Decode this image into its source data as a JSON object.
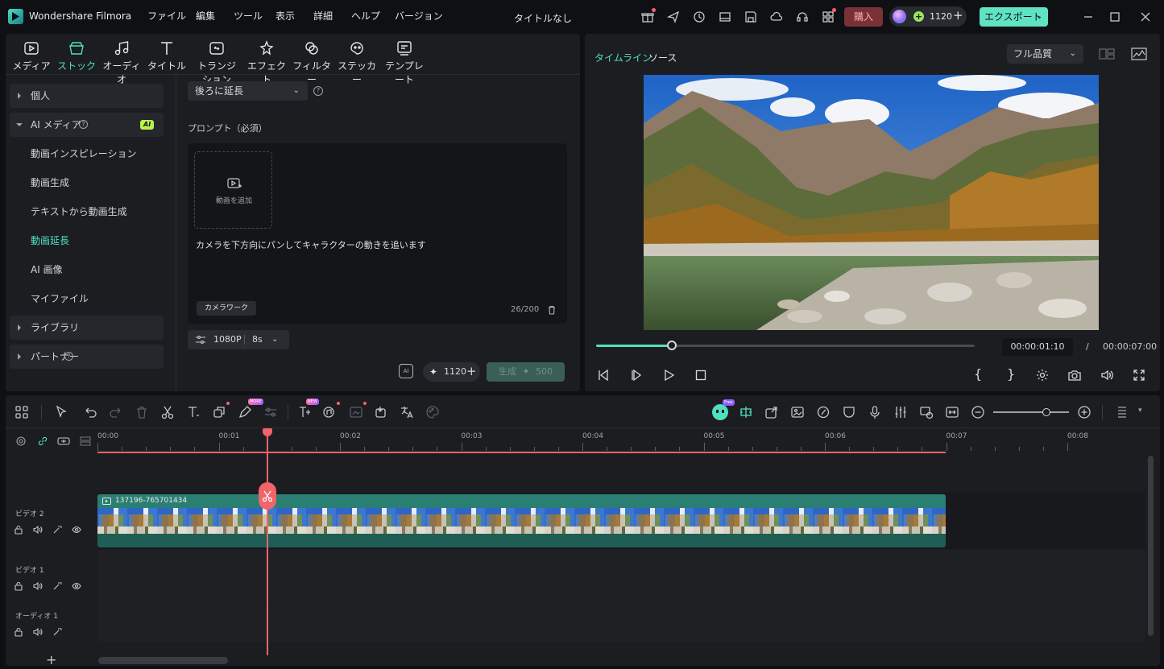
{
  "app": {
    "name": "Wondershare Filmora",
    "doc_title": "タイトルなし"
  },
  "menu": [
    "ファイル",
    "編集",
    "ツール",
    "表示",
    "詳細",
    "ヘルプ",
    "バージョン"
  ],
  "titlebar": {
    "buy_label": "購入",
    "credits": "1120",
    "export_label": "エクスポート"
  },
  "toolbar_tabs": [
    {
      "label": "メディア",
      "icon": "media-icon"
    },
    {
      "label": "ストック",
      "icon": "stock-icon"
    },
    {
      "label": "オーディオ",
      "icon": "audio-icon"
    },
    {
      "label": "タイトル",
      "icon": "title-icon"
    },
    {
      "label": "トランジション",
      "icon": "transition-icon"
    },
    {
      "label": "エフェクト",
      "icon": "effect-icon"
    },
    {
      "label": "フィルター",
      "icon": "filter-icon"
    },
    {
      "label": "ステッカー",
      "icon": "sticker-icon"
    },
    {
      "label": "テンプレート",
      "icon": "template-icon"
    }
  ],
  "sidebar": {
    "personal": "個人",
    "ai_media": "AI メディア",
    "ai_badge": "AI",
    "items": [
      "動画インスピレーション",
      "動画生成",
      "テキストから動画生成",
      "動画延長",
      "AI 画像",
      "マイファイル"
    ],
    "library": "ライブラリ",
    "partner": "パートナー"
  },
  "extend": {
    "mode_value": "後ろに延長",
    "prompt_label": "プロンプト（必須）",
    "add_video_label": "動画を追加",
    "prompt_text": "カメラを下方向にパンしてキャラクターの動きを追います",
    "camera_work_chip": "カメラワーク",
    "char_count": "26/200",
    "resolution": "1080P",
    "duration": "8s",
    "credits": "1120",
    "generate_label": "生成",
    "generate_cost": "500"
  },
  "preview": {
    "tab_timeline": "タイムライン",
    "tab_source": "ソース",
    "quality": "フル品質",
    "current_time": "00:00:01:10",
    "separator": "/",
    "total_time": "00:00:07:00",
    "progress": 0.2
  },
  "timeline": {
    "ruler_labels": [
      "00:00",
      "00:01",
      "00:02",
      "00:03",
      "00:04",
      "00:05",
      "00:06",
      "00:07",
      "00:08"
    ],
    "badges": {
      "new": "NEW",
      "free": "Free",
      "more": "MORE"
    },
    "clip_name": "137196-765701434",
    "tracks": [
      "ビデオ 2",
      "ビデオ 1",
      "オーディオ 1"
    ]
  },
  "colors": {
    "accent": "#4fe0c0",
    "playhead": "#f0646b",
    "buy": "#7a3135",
    "export": "#5fe3c3"
  }
}
